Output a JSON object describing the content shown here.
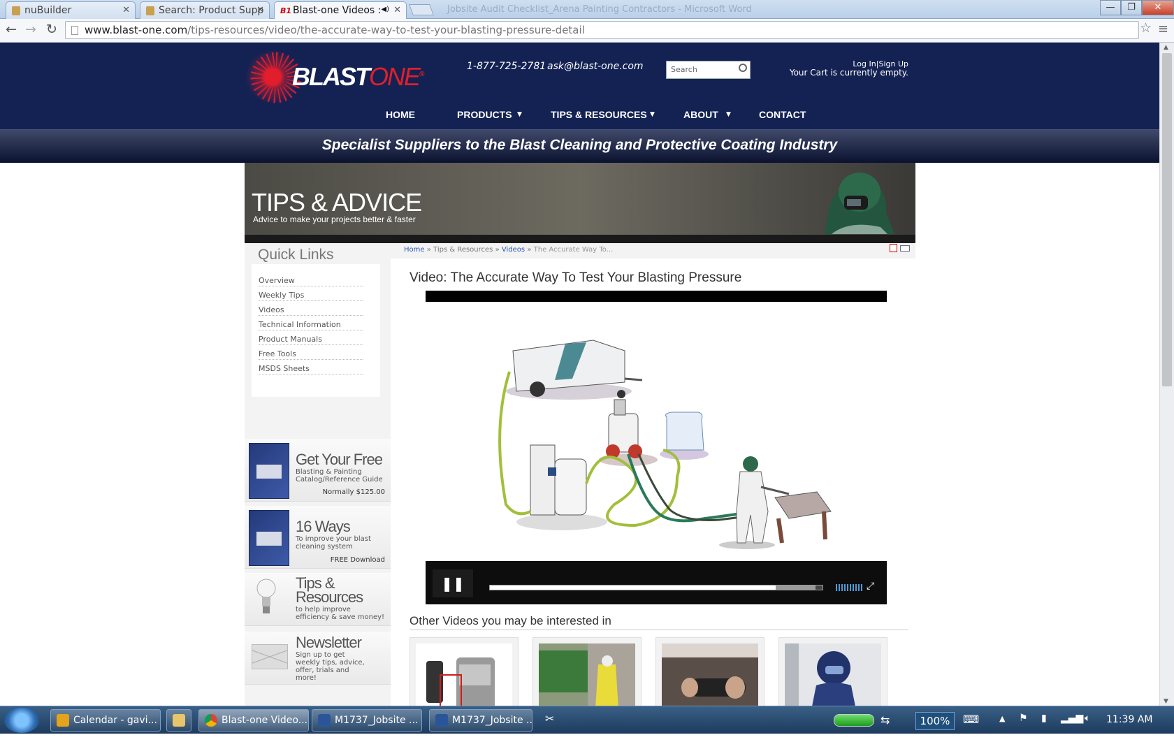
{
  "browser": {
    "tabs": [
      {
        "label": "nuBuilder"
      },
      {
        "label": "Search: Product Supp"
      },
      {
        "label": "Blast-one Videos :"
      }
    ],
    "address_domain": "www.blast-one.com",
    "address_path": "/tips-resources/video/the-accurate-way-to-test-your-blasting-pressure-detail",
    "background_window_title": "Jobsite Audit Checklist_Arena Painting Contractors - Microsoft Word"
  },
  "header": {
    "logo_blast": "BLAST",
    "logo_one": "ONE",
    "logo_mark": "®",
    "phone": "1-877-725-2781",
    "email": "ask@blast-one.com",
    "search_placeholder": "Search",
    "login": "Log In",
    "signup": "Sign Up",
    "cart": "Your Cart is currently empty.",
    "nav": [
      "HOME",
      "PRODUCTS",
      "TIPS & RESOURCES",
      "ABOUT",
      "CONTACT"
    ],
    "tagline": "Specialist Suppliers to the Blast Cleaning and Protective Coating Industry"
  },
  "banner": {
    "title": "TIPS & ADVICE",
    "subtitle": "Advice to make your projects better & faster"
  },
  "sidebar": {
    "quick_links_title": "Quick Links",
    "links": [
      "Overview",
      "Weekly Tips",
      "Videos",
      "Technical Information",
      "Product Manuals",
      "Free Tools",
      "MSDS Sheets"
    ],
    "promos": [
      {
        "heading": "Get Your Free",
        "sub": "Blasting & Painting Catalog/Reference Guide",
        "foot": "Normally $125.00"
      },
      {
        "heading": "16 Ways",
        "sub": "To improve your blast cleaning system",
        "foot": "FREE Download"
      },
      {
        "heading": "Tips & Resources",
        "sub": "to help improve efficiency & save money!",
        "foot": ""
      },
      {
        "heading": "Newsletter",
        "sub": "Sign up to get weekly tips, advice, offer, trials and more!",
        "foot": ""
      }
    ]
  },
  "breadcrumb": {
    "home": "Home",
    "sep": "»",
    "tips": "Tips & Resources",
    "videos": "Videos",
    "current": "The Accurate Way To..."
  },
  "video": {
    "title": "Video: The Accurate Way To Test Your Blasting Pressure",
    "progress": 0.86,
    "buffered": 0.98
  },
  "other_videos": {
    "title": "Other Videos you may be interested in"
  },
  "taskbar": {
    "items": [
      {
        "label": "Calendar - gavi..."
      },
      {
        "label": ""
      },
      {
        "label": "Blast-one Video..."
      },
      {
        "label": "M1737_Jobsite ..."
      },
      {
        "label": "M1737_Jobsite ..."
      }
    ],
    "zoom": "100%",
    "clock": "11:39 AM"
  },
  "colors": {
    "header_navy": "#142253",
    "brand_red": "#e01f2b",
    "link_blue": "#2d55b4"
  }
}
